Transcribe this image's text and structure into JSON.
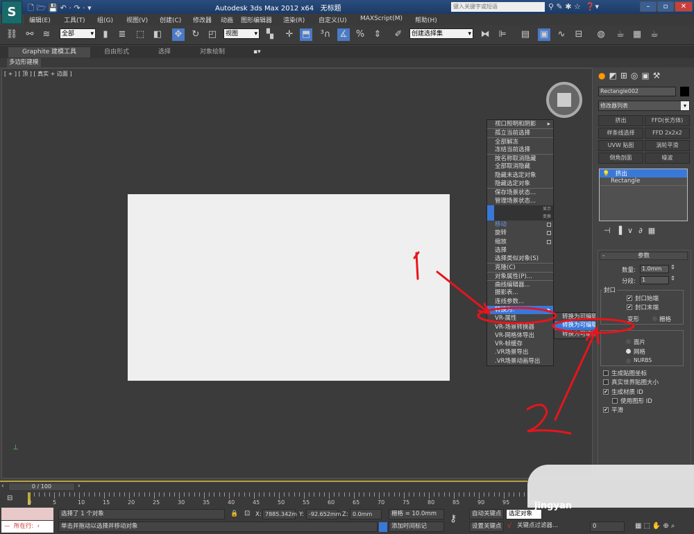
{
  "title_bar": {
    "app_title": "Autodesk 3ds Max  2012 x64",
    "doc_title": "无标题",
    "search_placeholder": "键入关键字或短语",
    "logo": "S"
  },
  "menu": [
    "编辑(E)",
    "工具(T)",
    "组(G)",
    "视图(V)",
    "创建(C)",
    "修改器",
    "动画",
    "图形编辑器",
    "渲染(R)",
    "自定义(U)",
    "MAXScript(M)",
    "帮助(H)"
  ],
  "toolbar": {
    "selection_filter": "全部",
    "ref_coord": "视图",
    "named_selection": "创建选择集"
  },
  "ribbon": {
    "tabs": [
      "Graphite 建模工具",
      "自由形式",
      "选择",
      "对象绘制"
    ],
    "sub_tab": "多边形建模"
  },
  "viewport": {
    "label": "[ + ] [ 顶 ] [ 真实 + 边面 ]"
  },
  "context_menu": {
    "items": [
      {
        "label": "视口照明和阴影",
        "arrow": "▸"
      },
      {
        "label": "孤立当前选择",
        "sep": true
      },
      {
        "label": "全部解冻",
        "sep": true
      },
      {
        "label": "冻结当前选择"
      },
      {
        "label": "按名称取消隐藏",
        "sep": true
      },
      {
        "label": "全部取消隐藏"
      },
      {
        "label": "隐藏未选定对象"
      },
      {
        "label": "隐藏选定对象"
      },
      {
        "label": "保存场景状态...",
        "sep": true
      },
      {
        "label": "管理场景状态..."
      },
      {
        "label": "显示",
        "bar": true
      },
      {
        "label": "变换",
        "bar": true
      },
      {
        "label": "移动",
        "blue": true,
        "box": true
      },
      {
        "label": "旋转",
        "box": true
      },
      {
        "label": "缩放",
        "box": true
      },
      {
        "label": "选择"
      },
      {
        "label": "选择类似对象(S)"
      },
      {
        "label": "克隆(C)",
        "sep": true
      },
      {
        "label": "对象属性(P)...",
        "sep": true
      },
      {
        "label": "曲线编辑器...",
        "sep": true
      },
      {
        "label": "摄影表..."
      },
      {
        "label": "连线参数..."
      },
      {
        "label": "转换为:",
        "hl": true,
        "arrow": "▸"
      },
      {
        "label": "VR-属性"
      },
      {
        "label": "VR-场景转换器"
      },
      {
        "label": "VR-网格体导出"
      },
      {
        "label": "VR-帧缓存"
      },
      {
        "label": ".VR场景导出"
      },
      {
        "label": ".VR场景动画导出"
      }
    ]
  },
  "submenu": {
    "items": [
      {
        "label": "转换为可编辑网格"
      },
      {
        "label": "转换为可编辑多边形",
        "hl": true
      },
      {
        "label": "转换为可编辑面片"
      }
    ]
  },
  "annotations": {
    "num1": "1",
    "num2": "2",
    "color": "#e8141c"
  },
  "panel": {
    "object_name": "Rectangle002",
    "modifier_list": "修改器列表",
    "modifier_buttons": [
      "挤出",
      "FFD(长方体)",
      "样条线选择",
      "FFD 2x2x2",
      "UVW 贴图",
      "涡轮平滑",
      "倒角剖面",
      "噪波"
    ],
    "stack": [
      "挤出",
      "Rectangle"
    ],
    "rollout_title": "参数",
    "amount_label": "数量:",
    "amount_value": "1.0mm",
    "segments_label": "分段:",
    "segments_value": "1",
    "capping_label": "封口",
    "cap_start": "封口始端",
    "cap_end": "封口末端",
    "morph": "变形",
    "grid": "栅格",
    "output_patch": "面片",
    "output_mesh": "网格",
    "output_nurbs": "NURBS",
    "gen_map": "生成贴图坐标",
    "real_world": "真实世界贴图大小",
    "gen_mat": "生成材质 ID",
    "use_shape": "使用图形 ID",
    "smooth": "平滑",
    "checks": {
      "cap_start": true,
      "cap_end": true,
      "gen_map": false,
      "real_world": false,
      "gen_mat": true,
      "use_shape": false,
      "smooth": true
    },
    "output_selected": "网格"
  },
  "timeline": {
    "frame": "0 / 100",
    "ticks": [
      "0",
      "5",
      "10",
      "15",
      "20",
      "25",
      "30",
      "35",
      "40",
      "45",
      "50",
      "55",
      "60",
      "65",
      "70",
      "75",
      "80",
      "85",
      "90",
      "95",
      "100"
    ]
  },
  "status": {
    "mini_listener": "所在行:",
    "selected": "选择了 1 个对象",
    "prompt": "单击并拖动以选择并移动对象",
    "x_label": "X:",
    "x": "7885.342m",
    "y_label": "Y:",
    "y": "-92.652mm",
    "z_label": "Z:",
    "z": "0.0mm",
    "grid": "栅格 = 10.0mm",
    "add_tag": "添加时间标记",
    "auto_key": "自动关键点",
    "set_key": "设置关键点",
    "key_mode": "选定对象",
    "key_filters": "关键点过滤器...",
    "frame_field": "0",
    "watermark": "jingyan"
  }
}
